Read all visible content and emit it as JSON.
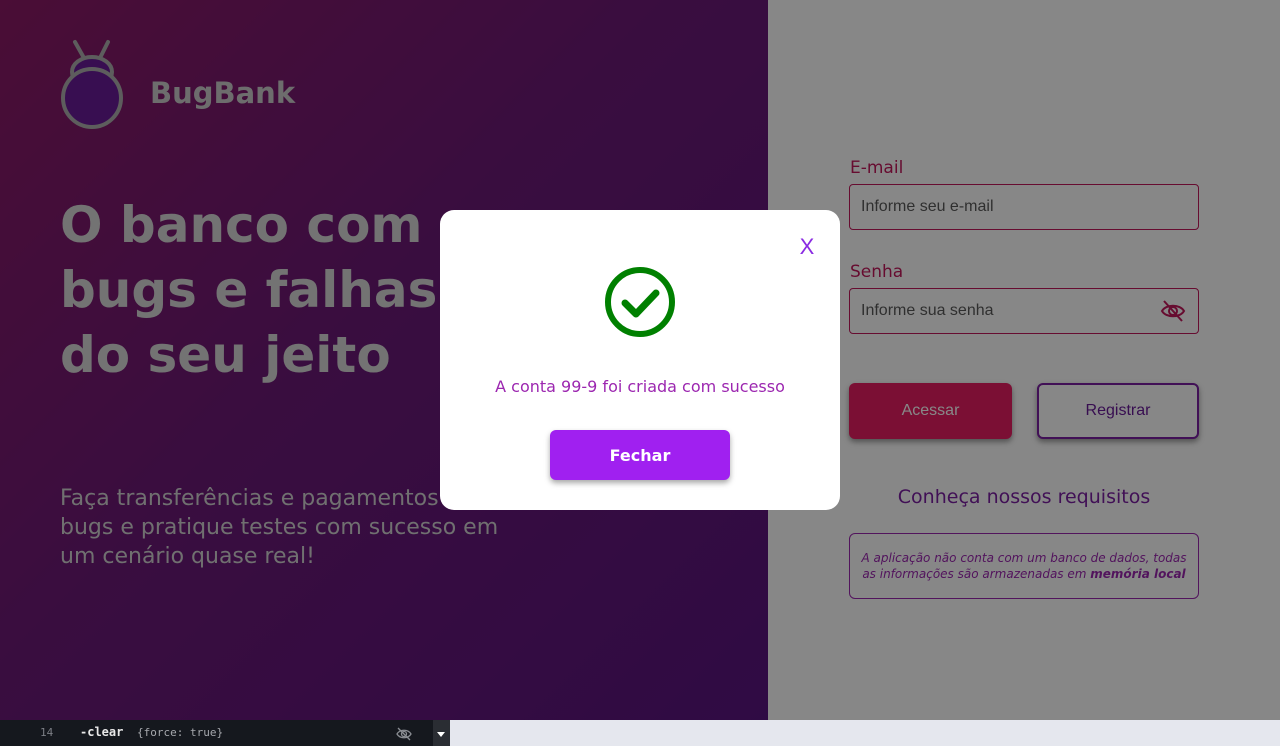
{
  "brand": {
    "name": "BugBank",
    "logo_icon": "bug-logo-icon"
  },
  "hero": {
    "headline": [
      "O banco com",
      "bugs e falhas",
      "do seu jeito"
    ],
    "subtext": "Faça transferências e pagamentos com bugs e pratique testes com sucesso em um cenário quase real!"
  },
  "login": {
    "email_label": "E-mail",
    "email_placeholder": "Informe seu e-mail",
    "password_label": "Senha",
    "password_placeholder": "Informe sua senha",
    "password_toggle_icon": "eye-off-icon",
    "access_label": "Acessar",
    "register_label": "Registrar"
  },
  "requirements": {
    "title": "Conheça nossos requisitos",
    "text": "A aplicação não conta com um banco de dados, todas as informações são armazenadas em",
    "highlight": "memória local"
  },
  "modal": {
    "icon": "success-check-icon",
    "close_label": "X",
    "message": "A conta 99-9 foi criada com sucesso",
    "button_label": "Fechar"
  },
  "devbar": {
    "line_number": "14",
    "command": "-clear",
    "args": "{force: true}"
  },
  "colors": {
    "primary": "#a020f0",
    "accent": "#e91e63",
    "success": "#008000"
  }
}
